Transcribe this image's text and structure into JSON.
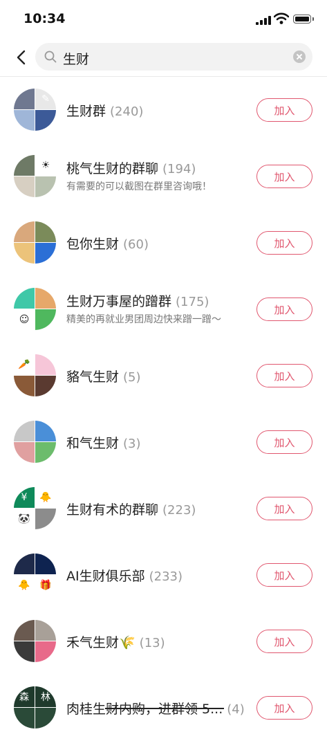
{
  "status": {
    "time": "10:34"
  },
  "search": {
    "query": "生财"
  },
  "results": [
    {
      "name": "生财群",
      "count": "(240)",
      "subtitle": "",
      "button": "加入",
      "quads": [
        {
          "bg": "#6f7890",
          "glyph": ""
        },
        {
          "bg": "#e8e8e8",
          "glyph": "✎"
        },
        {
          "bg": "#9fb6d8",
          "glyph": ""
        },
        {
          "bg": "#3c5a98",
          "glyph": ""
        }
      ]
    },
    {
      "name": "桃气生财的群聊",
      "count": "(194)",
      "subtitle": "有需要的可以截图在群里咨询哦！",
      "button": "加入",
      "quads": [
        {
          "bg": "#6e7a66",
          "glyph": ""
        },
        {
          "bg": "#ffffff",
          "glyph": "☀"
        },
        {
          "bg": "#d7cfc2",
          "glyph": ""
        },
        {
          "bg": "#b9c2b0",
          "glyph": ""
        }
      ]
    },
    {
      "name": "包你生财",
      "count": "(60)",
      "subtitle": "",
      "button": "加入",
      "quads": [
        {
          "bg": "#d9a87c",
          "glyph": ""
        },
        {
          "bg": "#7b8b5a",
          "glyph": ""
        },
        {
          "bg": "#ecc37a",
          "glyph": ""
        },
        {
          "bg": "#2b6fd6",
          "glyph": ""
        }
      ]
    },
    {
      "name": "生财万事屋的蹭群",
      "count": "(175)",
      "subtitle": "精美的再就业男团周边快来蹭一蹭～",
      "button": "加入",
      "quads": [
        {
          "bg": "#3fc8a8",
          "glyph": ""
        },
        {
          "bg": "#e6a86a",
          "glyph": ""
        },
        {
          "bg": "#ffffff",
          "glyph": "☺"
        },
        {
          "bg": "#4fb85e",
          "glyph": ""
        }
      ]
    },
    {
      "name": "貉气生财",
      "count": "(5)",
      "subtitle": "",
      "button": "加入",
      "quads": [
        {
          "bg": "#ffffff",
          "glyph": "🥕"
        },
        {
          "bg": "#f6c6d8",
          "glyph": ""
        },
        {
          "bg": "#8a5a38",
          "glyph": ""
        },
        {
          "bg": "#5a3a30",
          "glyph": ""
        }
      ]
    },
    {
      "name": "和气生财",
      "count": "(3)",
      "subtitle": "",
      "button": "加入",
      "quads": [
        {
          "bg": "#c8c8c8",
          "glyph": ""
        },
        {
          "bg": "#4a8fd8",
          "glyph": ""
        },
        {
          "bg": "#e0a0a0",
          "glyph": ""
        },
        {
          "bg": "#6cbc6c",
          "glyph": ""
        }
      ]
    },
    {
      "name": "生财有术的群聊",
      "count": "(223)",
      "subtitle": "",
      "button": "加入",
      "quads": [
        {
          "bg": "#0f8a5a",
          "glyph": "¥"
        },
        {
          "bg": "#ffffff",
          "glyph": "🐥"
        },
        {
          "bg": "#ffffff",
          "glyph": "🐼"
        },
        {
          "bg": "#8c8c8c",
          "glyph": ""
        }
      ]
    },
    {
      "name": "AI生财俱乐部",
      "count": "(233)",
      "subtitle": "",
      "button": "加入",
      "quads": [
        {
          "bg": "#1e2a4a",
          "glyph": ""
        },
        {
          "bg": "#0e2350",
          "glyph": ""
        },
        {
          "bg": "#ffffff",
          "glyph": "🐥"
        },
        {
          "bg": "#ffffff",
          "glyph": "🎁"
        }
      ]
    },
    {
      "name": "禾气生财🌾",
      "count": "(13)",
      "subtitle": "",
      "button": "加入",
      "quads": [
        {
          "bg": "#6a5a50",
          "glyph": ""
        },
        {
          "bg": "#a8a098",
          "glyph": ""
        },
        {
          "bg": "#3a3a3a",
          "glyph": ""
        },
        {
          "bg": "#e86a8a",
          "glyph": ""
        }
      ]
    },
    {
      "name": "肉桂生财内购，进群领 5...",
      "count": "(4)",
      "subtitle": "",
      "button": "加入",
      "quads": [
        {
          "bg": "#1f3a2c",
          "glyph": "森"
        },
        {
          "bg": "#1f3a2c",
          "glyph": "林"
        },
        {
          "bg": "#2a4a38",
          "glyph": ""
        },
        {
          "bg": "#2a4a38",
          "glyph": ""
        }
      ]
    }
  ]
}
